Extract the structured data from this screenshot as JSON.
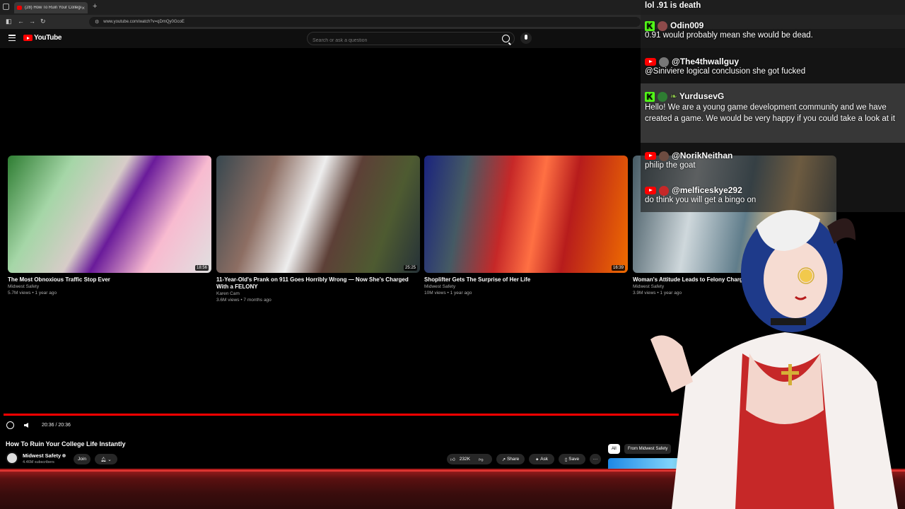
{
  "browser": {
    "tab_title": "(28) How To Ruin Your College",
    "url": "www.youtube.com/watch?v=qDmQy0GcoE"
  },
  "youtube": {
    "logo": "YouTube",
    "search_placeholder": "Search or ask a question"
  },
  "endscreen": [
    {
      "title": "The Most Obnoxious Traffic Stop Ever",
      "channel": "Midwest Safety",
      "meta": "5.7M views • 1 year ago",
      "duration": "18:56"
    },
    {
      "title": "11-Year-Old's Prank on 911 Goes Horribly Wrong — Now She's Charged With a FELONY",
      "channel": "Karen Cam",
      "meta": "3.6M views • 7 months ago",
      "duration": "25:25"
    },
    {
      "title": "Shoplifter Gets The Surprise of Her Life",
      "channel": "Midwest Safety",
      "meta": "10M views • 1 year ago",
      "duration": "16:39"
    },
    {
      "title": "Woman's Attitude Leads to Felony Charges",
      "channel": "Midwest Safety",
      "meta": "3.9M views • 1 year ago",
      "duration": ""
    }
  ],
  "player": {
    "time": "20:36 / 20:36",
    "progress_fraction": 1.0
  },
  "video": {
    "title": "How To Ruin Your College Life Instantly",
    "channel": "Midwest Safety",
    "subscribers": "4.46M subscribers",
    "join_label": "Join",
    "likes": "232K",
    "share_label": "Share",
    "ask_label": "Ask",
    "save_label": "Save"
  },
  "chips": [
    "All",
    "From Midwest Safety",
    "Po"
  ],
  "chat": {
    "top_line": "lol .91 is death",
    "messages": [
      {
        "platform": "kick",
        "user": "Odin009",
        "text": "0.91 would probably mean she would be dead."
      },
      {
        "platform": "youtube",
        "user": "@The4thwallguy",
        "text": "@Siniviere logical conclusion she got fucked"
      },
      {
        "platform": "kick",
        "user": "YurdusevG",
        "text": "Hello! We are a young game development community and we have created a game. We would be very happy if you could take a look at it"
      },
      {
        "platform": "youtube",
        "user": "@NorikNeithan",
        "text": "philip the goat"
      },
      {
        "platform": "youtube",
        "user": "@melficeskye292",
        "text": "do think you will get a bingo on"
      }
    ]
  },
  "colors": {
    "accent": "#ff0000",
    "kick": "#53fc18",
    "band": "#8e1a1a"
  }
}
